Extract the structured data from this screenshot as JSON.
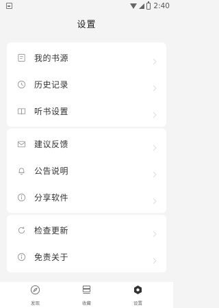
{
  "status_bar": {
    "time": "2:40"
  },
  "header": {
    "title": "设置"
  },
  "groups": [
    {
      "items": [
        {
          "label": "我的书源",
          "icon": "book-source-icon"
        },
        {
          "label": "历史记录",
          "icon": "clock-icon"
        },
        {
          "label": "听书设置",
          "icon": "open-book-icon"
        }
      ]
    },
    {
      "items": [
        {
          "label": "建议反馈",
          "icon": "mail-icon"
        },
        {
          "label": "公告说明",
          "icon": "bell-icon"
        },
        {
          "label": "分享软件",
          "icon": "info-icon"
        }
      ]
    },
    {
      "items": [
        {
          "label": "检查更新",
          "icon": "refresh-icon"
        },
        {
          "label": "免责关于",
          "icon": "info-icon"
        }
      ]
    }
  ],
  "tabbar": {
    "tabs": [
      {
        "label": "发现",
        "icon": "compass-icon"
      },
      {
        "label": "收藏",
        "icon": "bookshelf-icon"
      },
      {
        "label": "设置",
        "icon": "settings-icon"
      }
    ],
    "active_index": 2
  },
  "colors": {
    "background": "#f4f4f4",
    "card": "#ffffff",
    "text": "#333333",
    "icon": "#999999",
    "chevron": "#dddddd"
  }
}
